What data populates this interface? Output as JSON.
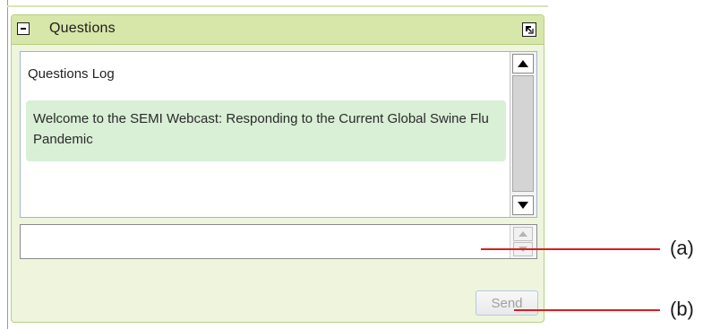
{
  "panel": {
    "title": "Questions"
  },
  "log": {
    "title": "Questions Log",
    "messages": [
      {
        "text": "Welcome to the SEMI Webcast: Responding to the Current Global Swine Flu Pandemic"
      }
    ]
  },
  "question_input": {
    "value": ""
  },
  "send_button": {
    "label": "Send"
  },
  "callouts": {
    "a": "(a)",
    "b": "(b)",
    "color": "#d62020"
  },
  "icons": {
    "collapse": "minus-box-icon",
    "popout": "popout-window-icon"
  }
}
